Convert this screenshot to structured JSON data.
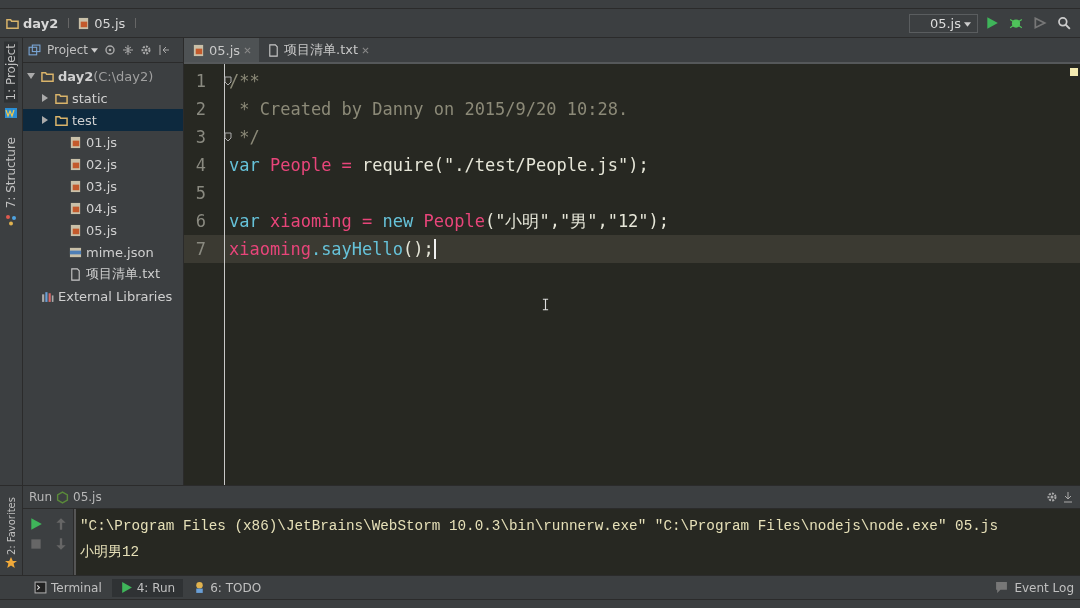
{
  "breadcrumb": [
    {
      "label": "day2",
      "kind": "folder"
    },
    {
      "label": "05.js",
      "kind": "js"
    }
  ],
  "run_config": {
    "label": "05.js"
  },
  "side_stripe": [
    {
      "label": "1: Project",
      "kind": "project"
    },
    {
      "label": "7: Structure",
      "kind": "structure"
    }
  ],
  "project_panel": {
    "title": "Project",
    "tree": [
      {
        "label": "day2",
        "detail": "(C:\\day2)",
        "kind": "folder",
        "expanded": true,
        "selected": false,
        "children": [
          {
            "label": "static",
            "kind": "folder",
            "expanded": false,
            "selected": false
          },
          {
            "label": "test",
            "kind": "folder",
            "expanded": false,
            "selected": true
          },
          {
            "label": "01.js",
            "kind": "js",
            "selected": false
          },
          {
            "label": "02.js",
            "kind": "js",
            "selected": false
          },
          {
            "label": "03.js",
            "kind": "js",
            "selected": false
          },
          {
            "label": "04.js",
            "kind": "js",
            "selected": false
          },
          {
            "label": "05.js",
            "kind": "js",
            "selected": false
          },
          {
            "label": "mime.json",
            "kind": "json",
            "selected": false
          },
          {
            "label": "项目清单.txt",
            "kind": "txt",
            "selected": false
          }
        ]
      },
      {
        "label": "External Libraries",
        "kind": "lib",
        "selected": false
      }
    ]
  },
  "editor_tabs": [
    {
      "label": "05.js",
      "kind": "js",
      "selected": true
    },
    {
      "label": "项目清单.txt",
      "kind": "txt",
      "selected": false
    }
  ],
  "code": [
    {
      "number": "1",
      "current": false,
      "fold": true,
      "tokens": [
        {
          "t": "/**",
          "kind": "comment"
        }
      ]
    },
    {
      "number": "2",
      "current": false,
      "fold": false,
      "tokens": [
        {
          "t": " * Created by Danny on 2015/9/20 10:28.",
          "kind": "comment"
        }
      ]
    },
    {
      "number": "3",
      "current": false,
      "fold": true,
      "tokens": [
        {
          "t": " */",
          "kind": "comment"
        }
      ]
    },
    {
      "number": "4",
      "current": false,
      "fold": false,
      "tokens": [
        {
          "t": "var ",
          "kind": "keyword"
        },
        {
          "t": "People = ",
          "kind": "ident"
        },
        {
          "t": "require(",
          "kind": "plain"
        },
        {
          "t": "\"./test/People.js\"",
          "kind": "string"
        },
        {
          "t": ");",
          "kind": "plain"
        }
      ]
    },
    {
      "number": "5",
      "current": false,
      "fold": false
    },
    {
      "number": "6",
      "current": false,
      "fold": false,
      "tokens": [
        {
          "t": "var ",
          "kind": "keyword"
        },
        {
          "t": "xiaoming = ",
          "kind": "ident"
        },
        {
          "t": "new ",
          "kind": "keyword"
        },
        {
          "t": "People",
          "kind": "ident"
        },
        {
          "t": "(",
          "kind": "plain"
        },
        {
          "t": "\"小明\"",
          "kind": "string"
        },
        {
          "t": ",",
          "kind": "plain"
        },
        {
          "t": "\"男\"",
          "kind": "string"
        },
        {
          "t": ",",
          "kind": "plain"
        },
        {
          "t": "\"12\"",
          "kind": "string"
        },
        {
          "t": ");",
          "kind": "plain"
        }
      ]
    },
    {
      "number": "7",
      "current": true,
      "fold": false,
      "tokens": [
        {
          "t": "xiaoming",
          "kind": "ident"
        },
        {
          "t": ".sayHello",
          "kind": "method"
        },
        {
          "t": "();",
          "kind": "plain"
        }
      ]
    }
  ],
  "run_panel": {
    "title": "Run",
    "config": "05.js",
    "output": [
      {
        "text": "\"C:\\Program Files (x86)\\JetBrains\\WebStorm 10.0.3\\bin\\runnerw.exe\" \"C:\\Program Files\\nodejs\\node.exe\" 05.js"
      },
      {
        "text": "小明男12"
      }
    ]
  },
  "bottom_tabs": [
    {
      "label": "Terminal",
      "kind": "terminal",
      "selected": false
    },
    {
      "label": "4: Run",
      "kind": "run",
      "selected": true
    },
    {
      "label": "6: TODO",
      "kind": "todo",
      "selected": false
    }
  ],
  "event_log": {
    "label": "Event Log"
  },
  "favorites": {
    "label": "2: Favorites"
  }
}
